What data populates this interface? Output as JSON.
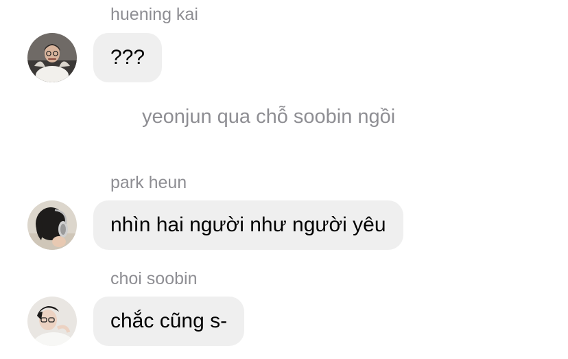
{
  "messages": [
    {
      "sender": "huening kai",
      "text": "???",
      "avatar": "avatar-huening-kai"
    },
    {
      "sender": "park heun",
      "text": "nhìn hai người như người yêu",
      "avatar": "avatar-park-heun"
    },
    {
      "sender": "choi soobin",
      "text": "chắc cũng s-",
      "avatar": "avatar-choi-soobin"
    }
  ],
  "system_notice": "yeonjun qua chỗ soobin ngồi",
  "colors": {
    "bubble_background": "#efefef",
    "sender_name": "#8e8e93",
    "system_text": "#8e8e93",
    "message_text": "#000000"
  }
}
